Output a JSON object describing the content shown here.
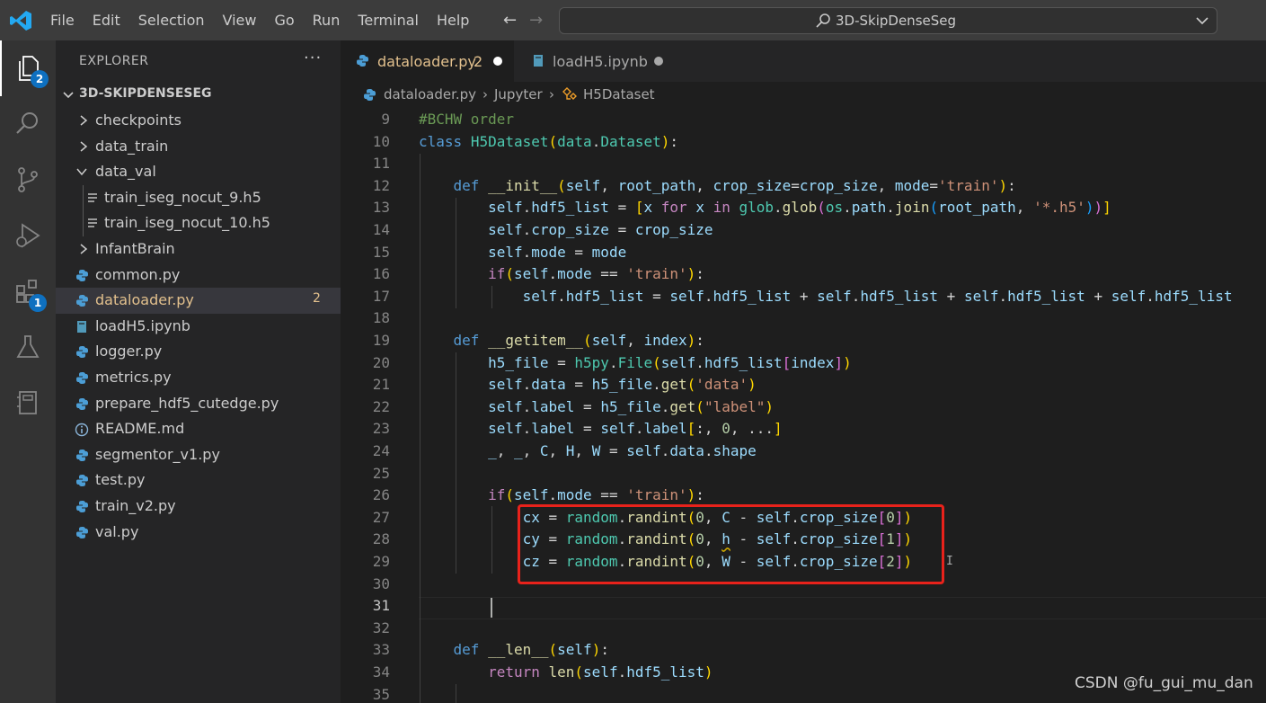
{
  "window": {
    "menu": [
      "File",
      "Edit",
      "Selection",
      "View",
      "Go",
      "Run",
      "Terminal",
      "Help"
    ],
    "command_center": "3D-SkipDenseSeg"
  },
  "activity_bar": {
    "explorer_badge": "2",
    "extensions_badge": "1"
  },
  "sidebar": {
    "title": "EXPLORER",
    "more": "···",
    "root": "3D-SKIPDENSESEG",
    "items": [
      {
        "label": "checkpoints",
        "kind": "folder"
      },
      {
        "label": "data_train",
        "kind": "folder"
      },
      {
        "label": "data_val",
        "kind": "folder-open"
      },
      {
        "label": "train_iseg_nocut_9.h5",
        "kind": "file"
      },
      {
        "label": "train_iseg_nocut_10.h5",
        "kind": "file"
      },
      {
        "label": "InfantBrain",
        "kind": "folder"
      },
      {
        "label": "common.py",
        "kind": "python"
      },
      {
        "label": "dataloader.py",
        "kind": "python",
        "count": "2"
      },
      {
        "label": "loadH5.ipynb",
        "kind": "notebook"
      },
      {
        "label": "logger.py",
        "kind": "python"
      },
      {
        "label": "metrics.py",
        "kind": "python"
      },
      {
        "label": "prepare_hdf5_cutedge.py",
        "kind": "python"
      },
      {
        "label": "README.md",
        "kind": "info"
      },
      {
        "label": "segmentor_v1.py",
        "kind": "python"
      },
      {
        "label": "test.py",
        "kind": "python"
      },
      {
        "label": "train_v2.py",
        "kind": "python"
      },
      {
        "label": "val.py",
        "kind": "python"
      }
    ]
  },
  "tabs": [
    {
      "label": "dataloader.py",
      "count": "2",
      "active": true
    },
    {
      "label": "loadH5.ipynb",
      "active": false
    }
  ],
  "breadcrumb": [
    "dataloader.py",
    "Jupyter",
    "H5Dataset"
  ],
  "editor": {
    "line_numbers": [
      "9",
      "10",
      "11",
      "12",
      "13",
      "14",
      "15",
      "16",
      "17",
      "18",
      "19",
      "20",
      "21",
      "22",
      "23",
      "24",
      "25",
      "26",
      "27",
      "28",
      "29",
      "30",
      "31",
      "32",
      "33",
      "34",
      "35"
    ],
    "current_line": "31"
  },
  "watermark": "CSDN @fu_gui_mu_dan",
  "colors": {
    "accent": "#0e70c0",
    "highlight_box": "#e8221b",
    "modified": "#e2c08d"
  }
}
